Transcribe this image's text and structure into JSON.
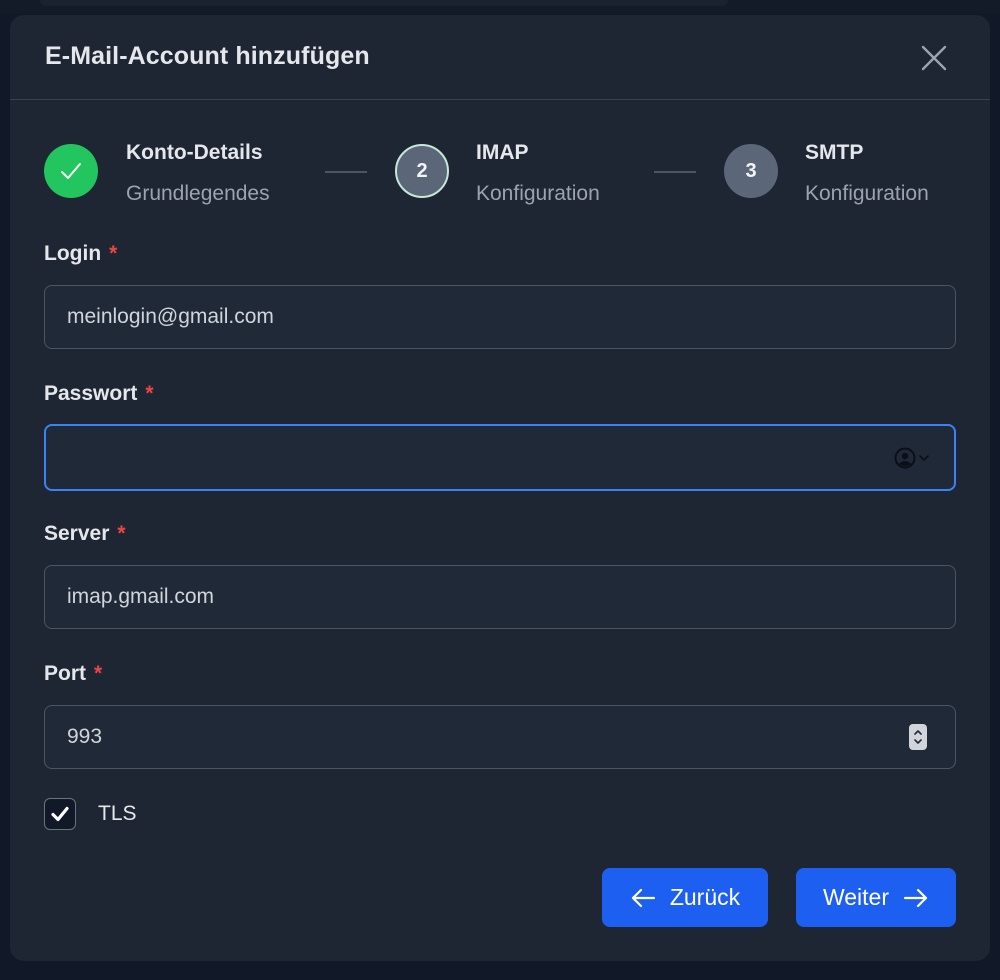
{
  "dialog": {
    "title": "E-Mail-Account hinzufügen",
    "close_icon": "close-icon"
  },
  "stepper": {
    "steps": [
      {
        "index": "1",
        "title": "Konto-Details",
        "subtitle": "Grundlegendes",
        "state": "done",
        "icon": "check-icon"
      },
      {
        "index": "2",
        "title": "IMAP",
        "subtitle": "Konfiguration",
        "state": "active"
      },
      {
        "index": "3",
        "title": "SMTP",
        "subtitle": "Konfiguration",
        "state": "pending"
      }
    ]
  },
  "form": {
    "required_marker": "*",
    "login": {
      "label": "Login",
      "value": "meinlogin@gmail.com"
    },
    "password": {
      "label": "Passwort",
      "value": "",
      "icon": "password-manager-icon"
    },
    "server": {
      "label": "Server",
      "value": "imap.gmail.com"
    },
    "port": {
      "label": "Port",
      "value": "993",
      "icon": "number-stepper-icon"
    },
    "tls": {
      "label": "TLS",
      "checked": true
    }
  },
  "actions": {
    "back_label": "Zurück",
    "back_icon": "arrow-left-icon",
    "next_label": "Weiter",
    "next_icon": "arrow-right-icon"
  },
  "colors": {
    "background": "#111827",
    "modal": "#1e2634",
    "primary": "#1d5ff0",
    "success": "#22c55e",
    "required": "#ef4444",
    "focus": "#3b82f6"
  }
}
